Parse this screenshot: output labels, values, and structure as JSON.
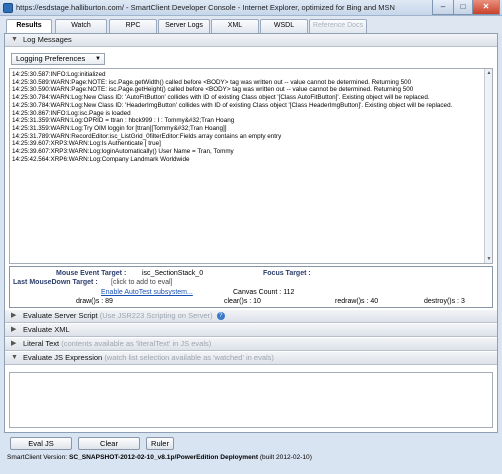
{
  "window": {
    "title": "https://esdstage.halliburton.com/ - SmartClient Developer Console - Internet Explorer, optimized for Bing and MSN",
    "min_glyph": "–",
    "max_glyph": "□",
    "close_glyph": "✕"
  },
  "tabs": [
    {
      "label": "Results",
      "active": true
    },
    {
      "label": "Watch"
    },
    {
      "label": "RPC"
    },
    {
      "label": "Server Logs"
    },
    {
      "label": "XML"
    },
    {
      "label": "WSDL"
    },
    {
      "label": "Reference Docs",
      "disabled": true
    }
  ],
  "log_section": {
    "header": "Log Messages",
    "prefs_label": "Logging Preferences",
    "lines": [
      "14:25:30.587:INFO:Log:initialized",
      "14:25:30.589:WARN:Page:NOTE: isc.Page.getWidth() called before <BODY> tag was written out -- value cannot be determined.  Returning 500",
      "14:25:30.590:WARN:Page:NOTE: isc.Page.getHeight() called before <BODY> tag was written out -- value cannot be determined.  Returning 500",
      "14:25:30.784:WARN:Log:New Class ID: 'AutoFitButton' collides with ID of existing Class object '[Class AutoFitButton]'.  Existing object will be replaced.",
      "14:25:30.784:WARN:Log:New Class ID: 'HeaderImgButton' collides with ID of existing Class object '[Class HeaderImgButton]'.  Existing object will be replaced.",
      "14:25:30.867:INFO:Log:isc.Page is loaded",
      "14:25:31.359:WARN:Log:OPRID = ttran : hbck999 : I : Tommy&#32;Tran Hoang",
      "14:25:31.359:WARN:Log:Try OIM loggin for [ttran][Tommy&#32;Tran Hoang]]",
      "14:25:31.789:WARN:RecordEditor:isc_ListGrid_0filterEditor:Fields array contains an empty entry",
      "14:25:39.607:XRP3:WARN:Log:Is Authenticate [ true]",
      "14:25:39.607:XRP3:WARN:Log:loginAutomatically() User Name = Tran, Tommy",
      "14:25:42.564:XRP6:WARN:Log:Company Landmark Worldwide"
    ]
  },
  "inspector": {
    "mouse_event_label": "Mouse Event Target :",
    "mouse_event_value": "isc_SectionStack_0",
    "focus_label": "Focus Target :",
    "last_mousedown_label": "Last MouseDown Target :",
    "last_mousedown_value": "[click to add to eval]",
    "autotest_link": "Enable AutoTest subsystem...",
    "canvas_count": "Canvas Count : 112",
    "draw": "draw()s : 89",
    "clear": "clear()s : 10",
    "redraw": "redraw()s : 40",
    "destroy": "destroy()s : 3"
  },
  "sections": {
    "server_script": {
      "label": "Evaluate Server Script",
      "hint": "(Use JSR223 Scripting on Server)",
      "help": "?"
    },
    "xml": {
      "label": "Evaluate XML"
    },
    "literal": {
      "label": "Literal Text",
      "hint": "(contents available as 'literalText' in JS evals)"
    },
    "js": {
      "label": "Evaluate JS Expression",
      "hint": "(watch list selection available as 'watched' in evals)"
    }
  },
  "glyphs": {
    "collapsed": "▶",
    "expanded": "▼",
    "dropdown": "▼",
    "scroll_up": "▲",
    "scroll_down": "▼"
  },
  "buttons": {
    "eval": "Eval JS",
    "clear": "Clear",
    "ruler": "Ruler"
  },
  "status": {
    "prefix": "SmartClient Version: ",
    "version": "SC_SNAPSHOT-2012-02-10_v8.1p/PowerEdition Deployment",
    "suffix": " (built 2012-02-10)"
  },
  "colors": {
    "accent": "#1a52b3",
    "close": "#c8412a"
  }
}
